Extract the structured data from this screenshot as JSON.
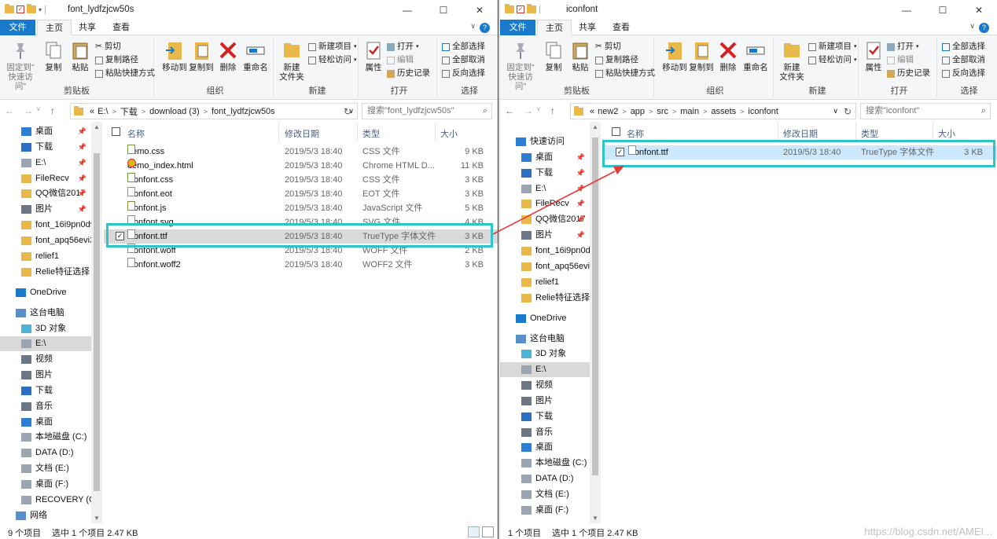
{
  "colors": {
    "accent": "#1979ca",
    "highlight": "#2cc4c9",
    "arrow": "#e53935",
    "selection": "#cce8ff"
  },
  "ribbon": {
    "tabs": [
      "文件",
      "主页",
      "共享",
      "查看"
    ],
    "pin": "固定到\"\n快速访问\"",
    "copy": "复制",
    "paste": "粘贴",
    "cut": "剪切",
    "copy_path": "复制路径",
    "paste_shortcut": "粘贴快捷方式",
    "clipboard": "剪贴板",
    "move_to": "移动到",
    "copy_to": "复制到",
    "delete": "删除",
    "rename": "重命名",
    "organize": "组织",
    "new_folder": "新建\n文件夹",
    "new_item": "新建项目",
    "easy_access": "轻松访问",
    "new": "新建",
    "properties": "属性",
    "open": "打开",
    "edit": "编辑",
    "history": "历史记录",
    "open_group": "打开",
    "select_all": "全部选择",
    "select_none": "全部取消",
    "invert": "反向选择",
    "select": "选择"
  },
  "left": {
    "title": "font_lydfzjcw50s",
    "breadcrumb": [
      "«",
      "E:\\",
      "下载",
      "download (3)",
      "font_lydfzjcw50s"
    ],
    "search_placeholder": "搜索\"font_lydfzjcw50s\"",
    "columns": [
      "名称",
      "修改日期",
      "类型",
      "大小"
    ],
    "files": [
      {
        "name": "demo.css",
        "date": "2019/5/3 18:40",
        "type": "CSS 文件",
        "size": "9 KB",
        "icon": "css-icon"
      },
      {
        "name": "demo_index.html",
        "date": "2019/5/3 18:40",
        "type": "Chrome HTML D...",
        "size": "11 KB",
        "icon": "chrome-icon"
      },
      {
        "name": "iconfont.css",
        "date": "2019/5/3 18:40",
        "type": "CSS 文件",
        "size": "3 KB",
        "icon": "css-icon"
      },
      {
        "name": "iconfont.eot",
        "date": "2019/5/3 18:40",
        "type": "EOT 文件",
        "size": "3 KB",
        "icon": "file-icon"
      },
      {
        "name": "iconfont.js",
        "date": "2019/5/3 18:40",
        "type": "JavaScript 文件",
        "size": "5 KB",
        "icon": "js-icon"
      },
      {
        "name": "iconfont.svg",
        "date": "2019/5/3 18:40",
        "type": "SVG 文件",
        "size": "4 KB",
        "icon": "file-icon"
      },
      {
        "name": "iconfont.ttf",
        "date": "2019/5/3 18:40",
        "type": "TrueType 字体文件",
        "size": "3 KB",
        "icon": "font-icon"
      },
      {
        "name": "iconfont.woff",
        "date": "2019/5/3 18:40",
        "type": "WOFF 文件",
        "size": "2 KB",
        "icon": "file-icon"
      },
      {
        "name": "iconfont.woff2",
        "date": "2019/5/3 18:40",
        "type": "WOFF2 文件",
        "size": "3 KB",
        "icon": "file-icon"
      }
    ],
    "nav": [
      "桌面",
      "下载",
      "E:\\",
      "FileRecv",
      "QQ微信2017",
      "图片",
      "font_16i9pn0d9",
      "font_apq56evi3",
      "relief1",
      "Relie特征选择",
      "OneDrive",
      "这台电脑",
      "3D 对象",
      "E:\\",
      "视频",
      "图片",
      "下载",
      "音乐",
      "桌面",
      "本地磁盘 (C:)",
      "DATA (D:)",
      "文档 (E:)",
      "桌面 (F:)",
      "RECOVERY (G:)",
      "网络"
    ],
    "status_count": "9 个项目",
    "status_sel": "选中 1 个项目  2.47 KB"
  },
  "right": {
    "title": "iconfont",
    "breadcrumb": [
      "«",
      "new2",
      "app",
      "src",
      "main",
      "assets",
      "iconfont"
    ],
    "search_placeholder": "搜索\"iconfont\"",
    "columns": [
      "名称",
      "修改日期",
      "类型",
      "大小"
    ],
    "files": [
      {
        "name": "iconfont.ttf",
        "date": "2019/5/3 18:40",
        "type": "TrueType 字体文件",
        "size": "3 KB",
        "icon": "font-icon"
      }
    ],
    "nav": [
      "快速访问",
      "桌面",
      "下载",
      "E:\\",
      "FileRecv",
      "QQ微信2017",
      "图片",
      "font_16i9pn0d9",
      "font_apq56evi3",
      "relief1",
      "Relie特征选择",
      "OneDrive",
      "这台电脑",
      "3D 对象",
      "E:\\",
      "视频",
      "图片",
      "下载",
      "音乐",
      "桌面",
      "本地磁盘 (C:)",
      "DATA (D:)",
      "文档 (E:)",
      "桌面 (F:)"
    ],
    "status_count": "1 个项目",
    "status_sel": "选中 1 个项目  2.47 KB"
  },
  "watermark": "https://blog.csdn.net/AMEI..."
}
